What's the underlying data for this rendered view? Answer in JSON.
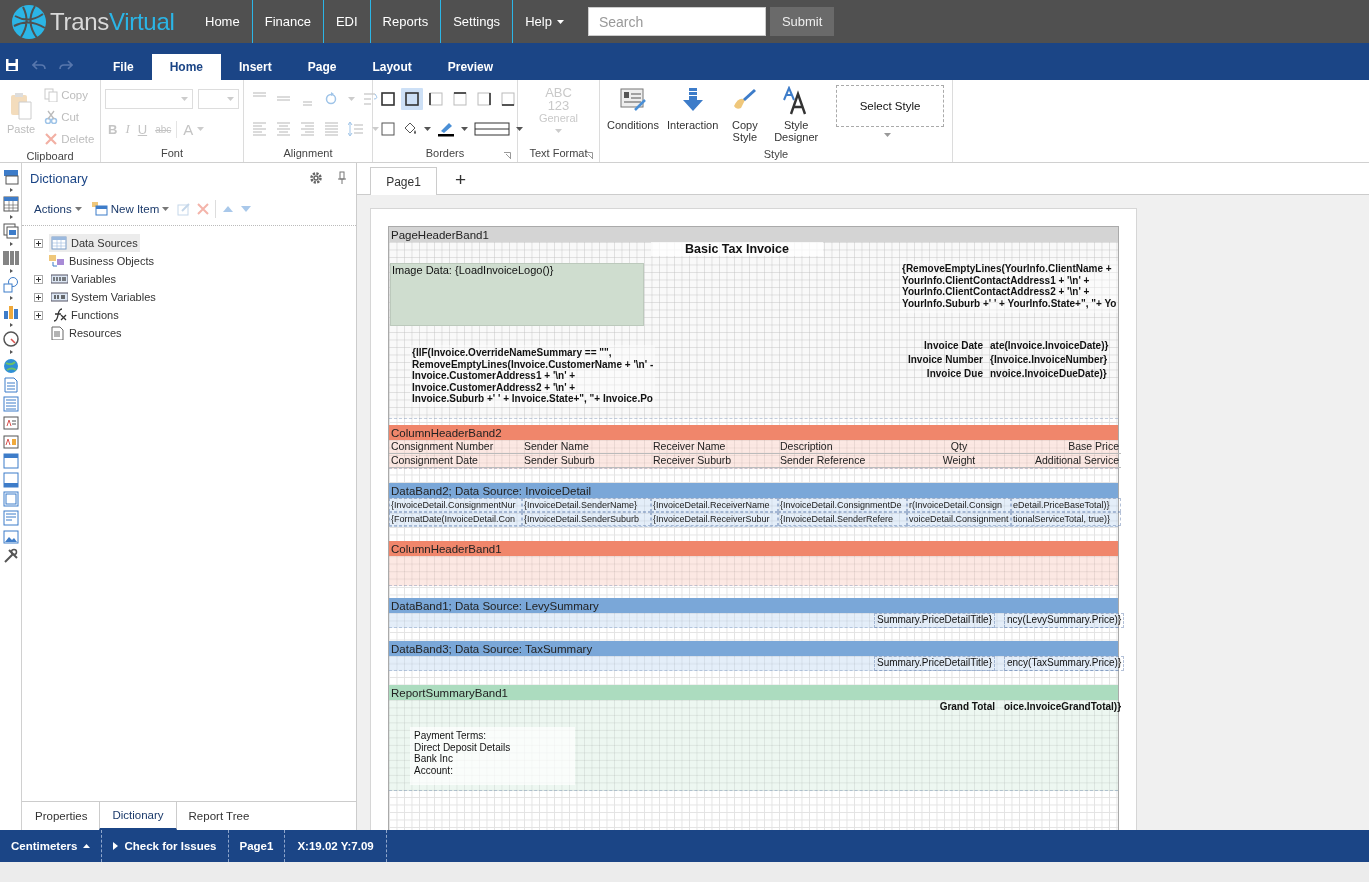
{
  "nav": {
    "brand": [
      "Trans",
      "Virtual"
    ],
    "items": [
      {
        "label": "Home",
        "kind": "link"
      },
      {
        "label": "Finance",
        "kind": "link"
      },
      {
        "label": "EDI",
        "kind": "link"
      },
      {
        "label": "Reports",
        "kind": "link"
      },
      {
        "label": "Settings",
        "kind": "link"
      },
      {
        "label": "Help",
        "kind": "dropdown"
      }
    ],
    "search": {
      "placeholder": "Search"
    },
    "submit": "Submit"
  },
  "ribbon": {
    "tabs": [
      {
        "label": "File",
        "selected": false
      },
      {
        "label": "Home",
        "selected": true
      },
      {
        "label": "Insert",
        "selected": false
      },
      {
        "label": "Page",
        "selected": false
      },
      {
        "label": "Layout",
        "selected": false
      },
      {
        "label": "Preview",
        "selected": false
      }
    ],
    "clipboard": {
      "label": "Clipboard",
      "items": [
        {
          "label": "Paste",
          "disabled": true
        },
        {
          "label": "Copy",
          "disabled": true
        },
        {
          "label": "Cut",
          "disabled": true
        },
        {
          "label": "Delete",
          "disabled": true
        }
      ]
    },
    "font": {
      "label": "Font",
      "buttons": [
        "B",
        "I",
        "U",
        "abc",
        "A"
      ]
    },
    "alignment": {
      "label": "Alignment"
    },
    "borders": {
      "label": "Borders",
      "buttons": [
        {
          "selected": false
        },
        {
          "selected": true
        },
        {
          "selected": false
        },
        {
          "selected": false
        },
        {
          "selected": false
        },
        {
          "selected": false
        }
      ]
    },
    "text_format": {
      "label": "Text Format",
      "sample": [
        "ABC",
        "123"
      ],
      "format": "General"
    },
    "style": {
      "label": "Style",
      "buttons": [
        "Conditions",
        "Interaction",
        "Copy Style",
        "Style Designer"
      ],
      "select": "Select Style"
    }
  },
  "sidebar": {
    "title": "Dictionary",
    "toolbar": [
      "Actions",
      "New Item"
    ],
    "tree": [
      {
        "label": "Data Sources",
        "expanded": false,
        "selected": true
      },
      {
        "label": "Business Objects",
        "selected": false
      },
      {
        "label": "Variables",
        "expanded": false,
        "selected": false
      },
      {
        "label": "System Variables",
        "expanded": false,
        "selected": false
      },
      {
        "label": "Functions",
        "expanded": false,
        "selected": false
      },
      {
        "label": "Resources",
        "selected": false
      }
    ],
    "tabs": [
      {
        "label": "Properties",
        "selected": false
      },
      {
        "label": "Dictionary",
        "selected": true
      },
      {
        "label": "Report Tree",
        "selected": false
      }
    ]
  },
  "designer": {
    "page_tabs": [
      {
        "label": "Page1",
        "selected": true
      }
    ],
    "add_tab": "+",
    "bands": [
      {
        "title": "PageHeaderBand1",
        "kind": "page_header",
        "components": [
          {
            "text": "Basic Tax Invoice"
          },
          {
            "text": "Image Data: {LoadInvoiceLogo()}"
          },
          {
            "text": "{RemoveEmptyLines(YourInfo.ClientName +\nYourInfo.ClientContactAddress1 + '\\n' +\nYourInfo.ClientContactAddress2 + '\\n' +\nYourInfo.Suburb +' ' + YourInfo.State+\", \"+ Yo"
          },
          {
            "text": "{IIF(Invoice.OverrideNameSummary == \"\",\nRemoveEmptyLines(Invoice.CustomerName + '\\n' -\nInvoice.CustomerAddress1 + '\\n' +\nInvoice.CustomerAddress2 + '\\n' +\nInvoice.Suburb +' ' + Invoice.State+\", \"+ Invoice.Po"
          },
          {
            "text": "Invoice Date"
          },
          {
            "text": "Invoice Number"
          },
          {
            "text": "Invoice Due"
          },
          {
            "text": "ate(Invoice.InvoiceDate)}"
          },
          {
            "text": "{Invoice.InvoiceNumber}"
          },
          {
            "text": "nvoice.InvoiceDueDate)}"
          }
        ]
      },
      {
        "title": "ColumnHeaderBand2",
        "kind": "column_header",
        "rows": [
          [
            "Consignment Number",
            "Sender Name",
            "Receiver Name",
            "Description",
            "Qty",
            "Base Price"
          ],
          [
            "Consignment Date",
            "Sender Suburb",
            "Receiver Suburb",
            "Sender Reference",
            "Weight",
            "Additional Service"
          ]
        ]
      },
      {
        "title": "DataBand2; Data Source: InvoiceDetail",
        "kind": "data",
        "rows": [
          [
            "{InvoiceDetail.ConsignmentNur",
            "{InvoiceDetail.SenderName}",
            "{InvoiceDetail.ReceiverName",
            "{InvoiceDetail.ConsignmentDe",
            "r(InvoiceDetail.Consign",
            "eDetail.PriceBaseTotal)}"
          ],
          [
            "{FormatDate(InvoiceDetail.Con",
            "{InvoiceDetail.SenderSuburb",
            "{InvoiceDetail.ReceiverSubur",
            "{InvoiceDetail.SenderRefere",
            "voiceDetail.Consignment",
            "tionalServiceTotal, true)}"
          ]
        ]
      },
      {
        "title": "ColumnHeaderBand1",
        "kind": "column_header"
      },
      {
        "title": "DataBand1; Data Source: LevySummary",
        "kind": "data",
        "components": [
          {
            "text": "Summary.PriceDetailTitle}"
          },
          {
            "text": "ncy(LevySummary.Price)}"
          }
        ]
      },
      {
        "title": "DataBand3; Data Source: TaxSummary",
        "kind": "data",
        "components": [
          {
            "text": "Summary.PriceDetailTitle}"
          },
          {
            "text": "ency(TaxSummary.Price)}"
          }
        ]
      },
      {
        "title": "ReportSummaryBand1",
        "kind": "summary",
        "components": [
          {
            "text": "Grand Total"
          },
          {
            "text": "oice.InvoiceGrandTotal)}"
          },
          {
            "text": "Payment Terms:\nDirect Deposit Details\nBank Inc\nAccount:"
          }
        ]
      }
    ]
  },
  "status_bar": {
    "units": "Centimeters",
    "check": "Check for Issues",
    "page": "Page1",
    "position": "X:19.02 Y:7.09"
  }
}
